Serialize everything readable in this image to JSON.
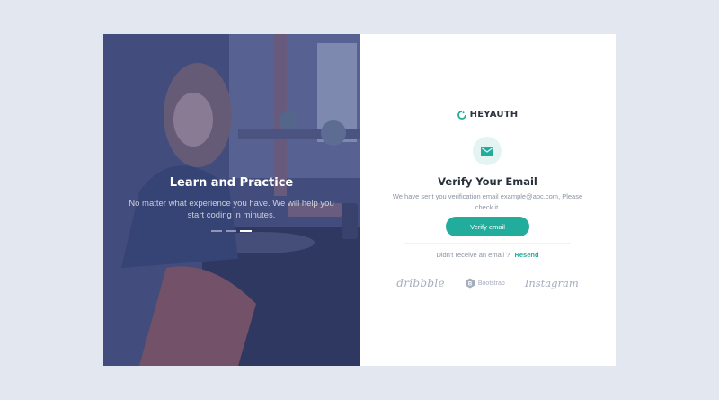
{
  "hero": {
    "title": "Learn and Practice",
    "subtitle": "No matter what experience you have. We will help you start coding in minutes.",
    "carousel": {
      "count": 3,
      "active_index": 2
    }
  },
  "brand": {
    "name": "HEYAUTH",
    "icon": "heyauth-logo-icon",
    "accent": "#22ac9c"
  },
  "verify": {
    "icon": "mail-icon",
    "title": "Verify Your Email",
    "description": "We have sent you verification email example@abc.com, Please check it.",
    "button_label": "Verify email"
  },
  "resend": {
    "prompt": "Didn't receive an email ?",
    "link_label": "Resend"
  },
  "partner_logos": {
    "dribbble": "dribbble",
    "bootstrap": "Bootstrap",
    "instagram": "Instagram"
  },
  "colors": {
    "page_background": "#e3e7ef",
    "hero_tint": "#3a4882",
    "button": "#22ac9c",
    "title_text": "#27303b",
    "muted_text": "#8a94a3"
  }
}
